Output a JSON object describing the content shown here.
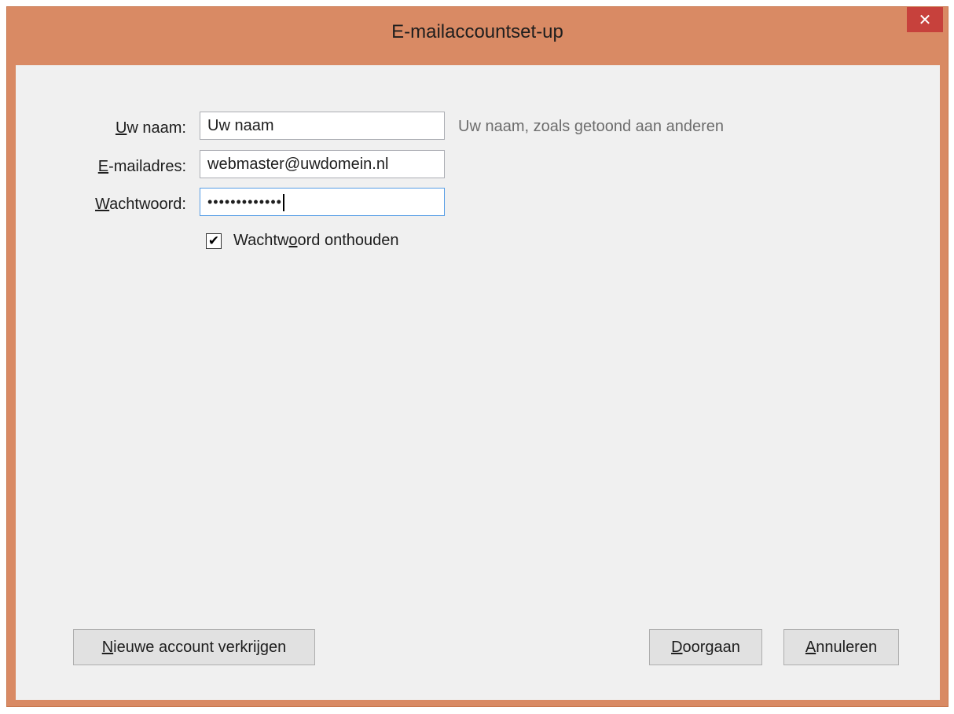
{
  "window": {
    "title": "E-mailaccountset-up",
    "close_glyph": "✕"
  },
  "form": {
    "name_label": {
      "mnemonic": "U",
      "rest": "w naam:"
    },
    "name_value": "Uw naam",
    "name_hint": "Uw naam, zoals getoond aan anderen",
    "email_label": {
      "mnemonic": "E",
      "rest": "-mailadres:"
    },
    "email_value": "webmaster@uwdomein.nl",
    "password_label": {
      "mnemonic": "W",
      "rest": "achtwoord:"
    },
    "password_masked": "•••••••••••••",
    "remember_label": {
      "pre": "Wachtw",
      "mnemonic": "o",
      "post": "ord onthouden"
    },
    "remember_checked": true,
    "check_glyph": "✔"
  },
  "buttons": {
    "new_account": {
      "mnemonic": "N",
      "rest": "ieuwe account verkrijgen"
    },
    "continue": {
      "mnemonic": "D",
      "rest": "oorgaan"
    },
    "cancel": {
      "mnemonic": "A",
      "rest": "nnuleren"
    }
  },
  "colors": {
    "titlebar": "#d98a64",
    "close_button": "#c7413c",
    "client_bg": "#f0f0f0",
    "focus_border": "#569de5"
  },
  "icons": {
    "close": "close-icon",
    "checkmark": "checkmark-icon"
  }
}
